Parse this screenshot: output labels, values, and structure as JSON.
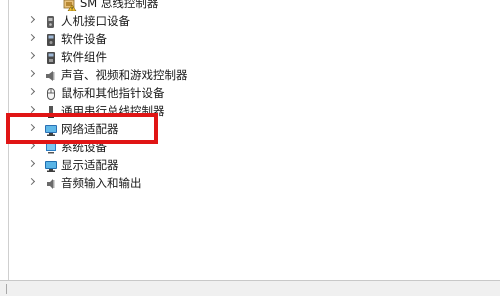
{
  "device_tree": {
    "items": [
      {
        "label": "SM 总线控制器",
        "icon": "sm-bus-controller-warning-icon",
        "expandable": false,
        "child": true
      },
      {
        "label": "人机接口设备",
        "icon": "hid-device-icon",
        "expandable": true
      },
      {
        "label": "软件设备",
        "icon": "software-device-icon",
        "expandable": true
      },
      {
        "label": "软件组件",
        "icon": "software-component-icon",
        "expandable": true
      },
      {
        "label": "声音、视频和游戏控制器",
        "icon": "speaker-icon",
        "expandable": true
      },
      {
        "label": "鼠标和其他指针设备",
        "icon": "mouse-icon",
        "expandable": true
      },
      {
        "label": "通用串行总线控制器",
        "icon": "usb-controller-icon",
        "expandable": true
      },
      {
        "label": "网络适配器",
        "icon": "network-adapter-icon",
        "expandable": true
      },
      {
        "label": "系统设备",
        "icon": "system-device-icon",
        "expandable": true
      },
      {
        "label": "显示适配器",
        "icon": "display-adapter-icon",
        "expandable": true
      },
      {
        "label": "音频输入和输出",
        "icon": "audio-io-icon",
        "expandable": true
      }
    ]
  },
  "colors": {
    "highlight_border": "#e01515",
    "status_bar": "#f0f0f0"
  }
}
